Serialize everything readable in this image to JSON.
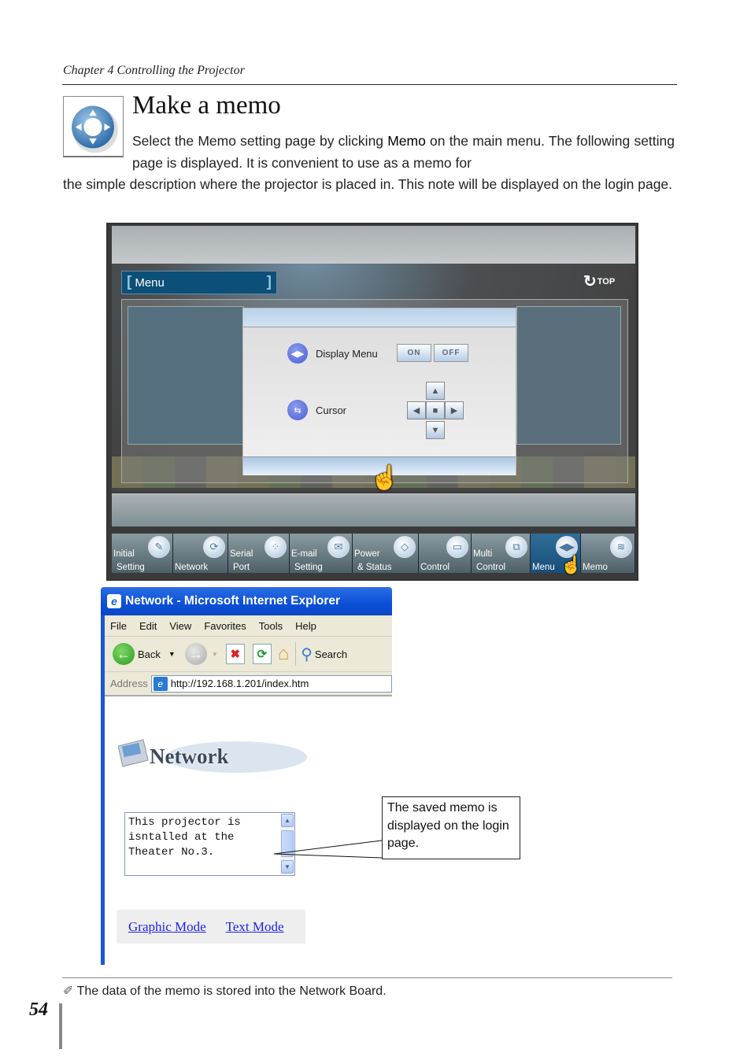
{
  "header": {
    "chapter": "Chapter 4 Controlling the Projector"
  },
  "section": {
    "icon": "cursor-pad-icon",
    "title": "Make a memo",
    "para1_a": "Select the Memo setting page by clicking ",
    "para1_bold": "Memo",
    "para1_b": " on the main menu. The following setting page is displayed. It is convenient to use as a memo for",
    "para2": "the simple description where the projector is placed in. This note will be displayed on the login page."
  },
  "projector_ui": {
    "menu_label": "Menu",
    "top_label": "TOP",
    "top_icon": "refresh-arrow-icon",
    "dialog": {
      "rows": [
        {
          "label": "Display Menu",
          "icon": "display-menu-icon"
        },
        {
          "label": "Cursor",
          "icon": "cursor-icon"
        }
      ],
      "on_label": "ON",
      "off_label": "OFF",
      "dpad": {
        "up": "▲",
        "down": "▼",
        "left": "◀",
        "right": "▶",
        "center": "■"
      }
    },
    "nav": [
      {
        "l1": "Initial",
        "l2": "Setting",
        "icon": "pen-icon",
        "glyph": "✎"
      },
      {
        "l1": "",
        "l2": "Network",
        "icon": "network-icon",
        "glyph": "⟳"
      },
      {
        "l1": "Serial",
        "l2": "Port",
        "icon": "serial-port-icon",
        "glyph": "⁘"
      },
      {
        "l1": "E-mail",
        "l2": "Setting",
        "icon": "mail-icon",
        "glyph": "✉"
      },
      {
        "l1": "Power",
        "l2": "& Status",
        "icon": "power-icon",
        "glyph": "◇"
      },
      {
        "l1": "",
        "l2": "Control",
        "icon": "control-icon",
        "glyph": "▭"
      },
      {
        "l1": "Multi",
        "l2": "Control",
        "icon": "multi-control-icon",
        "glyph": "⧉"
      },
      {
        "l1": "",
        "l2": "Menu",
        "icon": "menu-icon",
        "glyph": "◀▶",
        "active": true
      },
      {
        "l1": "",
        "l2": "Memo",
        "icon": "memo-icon",
        "glyph": "≋"
      }
    ]
  },
  "browser": {
    "title": "Network - Microsoft Internet Explorer",
    "menu": [
      "File",
      "Edit",
      "View",
      "Favorites",
      "Tools",
      "Help"
    ],
    "toolbar": {
      "back": "Back",
      "search": "Search"
    },
    "address_label": "Address",
    "url": "http://192.168.1.201/index.htm",
    "logo_text": "Network",
    "memo_text": "This projector is\nisntalled at the\nTheater No.3.",
    "links": [
      "Graphic Mode",
      "Text Mode"
    ]
  },
  "callout": {
    "text": "The saved memo is displayed on the login page."
  },
  "footer": {
    "note_icon": "pencil-icon",
    "note": "The data of the memo is stored into the Network Board.",
    "page_number": "54"
  }
}
